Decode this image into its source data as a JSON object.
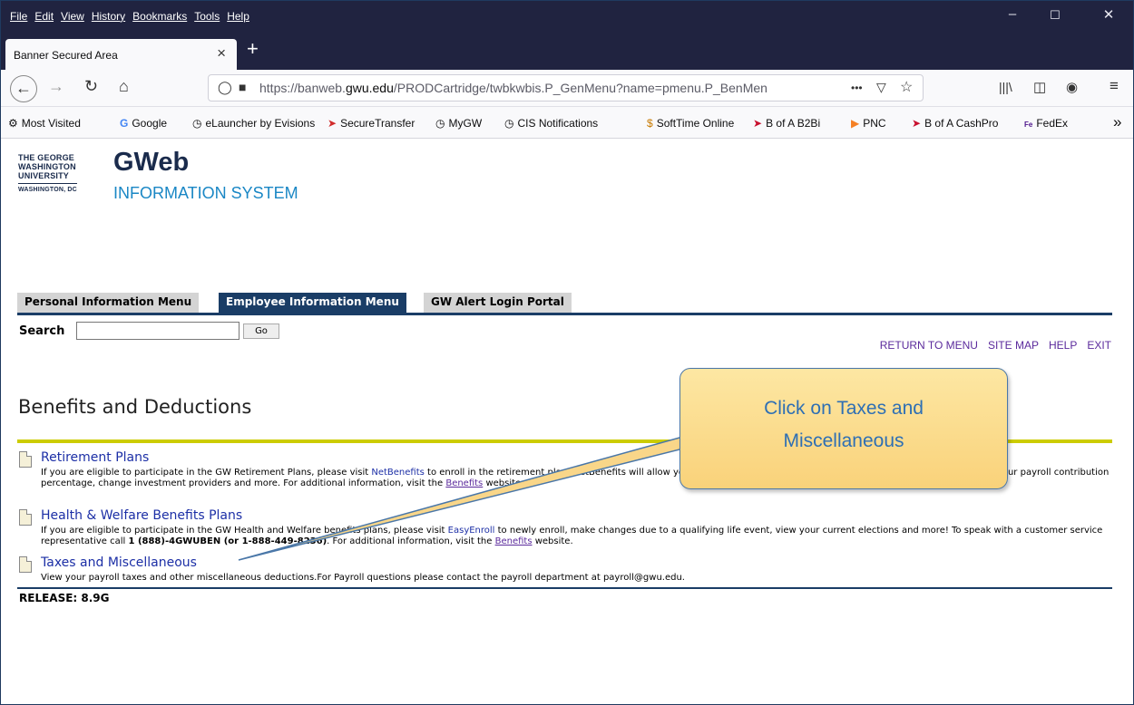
{
  "browser": {
    "menu": [
      "File",
      "Edit",
      "View",
      "History",
      "Bookmarks",
      "Tools",
      "Help"
    ],
    "tab_title": "Banner Secured Area",
    "url_prefix": "https://banweb.",
    "url_domain": "gwu.edu",
    "url_path": "/PRODCartridge/twbkwbis.P_GenMenu?name=pmenu.P_BenMen",
    "url_ellipsis": "•••",
    "bookmarks": [
      "Most Visited",
      "Google",
      "eLauncher by Evisions",
      "SecureTransfer",
      "MyGW",
      "CIS Notifications",
      "SoftTime Online",
      "B of A B2Bi",
      "PNC",
      "B of A CashPro",
      "FedEx"
    ],
    "overflow": "»"
  },
  "header": {
    "logo_line1": "THE GEORGE",
    "logo_line2": "WASHINGTON",
    "logo_line3": "UNIVERSITY",
    "logo_line4": "WASHINGTON, DC",
    "brand": "GWeb",
    "subtitle": "INFORMATION SYSTEM"
  },
  "tabs": [
    "Personal Information Menu",
    "Employee Information Menu",
    "GW Alert Login Portal"
  ],
  "search": {
    "label": "Search",
    "value": "",
    "go": "Go"
  },
  "toplinks": [
    "RETURN TO MENU",
    "SITE MAP",
    "HELP",
    "EXIT"
  ],
  "page_title": "Benefits and Deductions",
  "items": [
    {
      "title": "Retirement Plans",
      "desc_a": "If you are eligible to participate in the GW Retirement Plans, please visit ",
      "link": "NetBenefits",
      "desc_b": " to enroll in the retirement plan. NetBenefits will allow you to enroll with either investment provider (TIAA or Fidelity), change your payroll contribution percentage, change investment providers and more. For additional information, visit the ",
      "link2": "Benefits",
      "desc_c": " website."
    },
    {
      "title": "Health & Welfare Benefits Plans",
      "desc_a": "If you are eligible to participate in the GW Health and Welfare benefits plans, please visit ",
      "link": "EasyEnroll",
      "desc_b": " to newly enroll, make changes due to a qualifying life event, view your current elections and more! To speak with a customer service representative call ",
      "phone": "1 (888)-4GWUBEN (or 1-888-449-8236)",
      "desc_c": ". For additional information, visit the ",
      "link2": "Benefits",
      "desc_d": " website."
    },
    {
      "title": "Taxes and Miscellaneous",
      "desc_a": "View your payroll taxes and other miscellaneous deductions.For Payroll questions please contact the payroll department at payroll@gwu.edu."
    }
  ],
  "release": "RELEASE: 8.9G",
  "callout": {
    "line1": "Click on Taxes and",
    "line2": "Miscellaneous"
  }
}
